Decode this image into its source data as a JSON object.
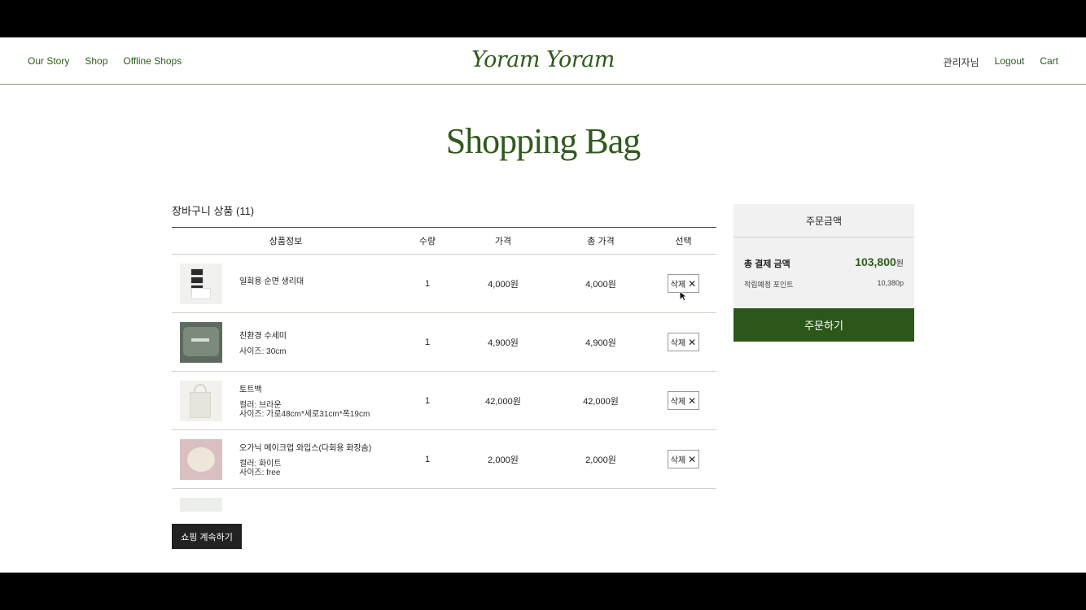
{
  "header": {
    "nav_left": [
      "Our Story",
      "Shop",
      "Offline Shops"
    ],
    "logo": "Yoram Yoram",
    "nav_right": {
      "admin": "관리자님",
      "logout": "Logout",
      "cart": "Cart"
    }
  },
  "page_title": "Shopping Bag",
  "cart": {
    "heading": "장바구니 상품 (11)",
    "columns": {
      "info": "상품정보",
      "qty": "수량",
      "price": "가격",
      "total": "총 가격",
      "select": "선택"
    },
    "delete_label": "삭제",
    "items": [
      {
        "name": "일회용 순면 생리대",
        "options": [],
        "qty": "1",
        "price": "4,000원",
        "total": "4,000원"
      },
      {
        "name": "친환경 수세미",
        "options": [
          "사이즈: 30cm"
        ],
        "qty": "1",
        "price": "4,900원",
        "total": "4,900원"
      },
      {
        "name": "토트백",
        "options": [
          "컬러: 브라운",
          "사이즈: 가로48cm*세로31cm*폭19cm"
        ],
        "qty": "1",
        "price": "42,000원",
        "total": "42,000원"
      },
      {
        "name": "오가닉 메이크업 와입스(다회용 화장솜)",
        "options": [
          "컬러: 화이트",
          "사이즈: free"
        ],
        "qty": "1",
        "price": "2,000원",
        "total": "2,000원"
      }
    ],
    "continue_label": "쇼핑 계속하기"
  },
  "summary": {
    "title": "주문금액",
    "total_label": "총 결제 금액",
    "total_amount": "103,800",
    "total_unit": "원",
    "points_label": "적립예정 포인트",
    "points_value": "10,380p",
    "order_button": "주문하기"
  },
  "colors": {
    "brand_green": "#2f5a1c",
    "order_button": "#2b5819"
  }
}
